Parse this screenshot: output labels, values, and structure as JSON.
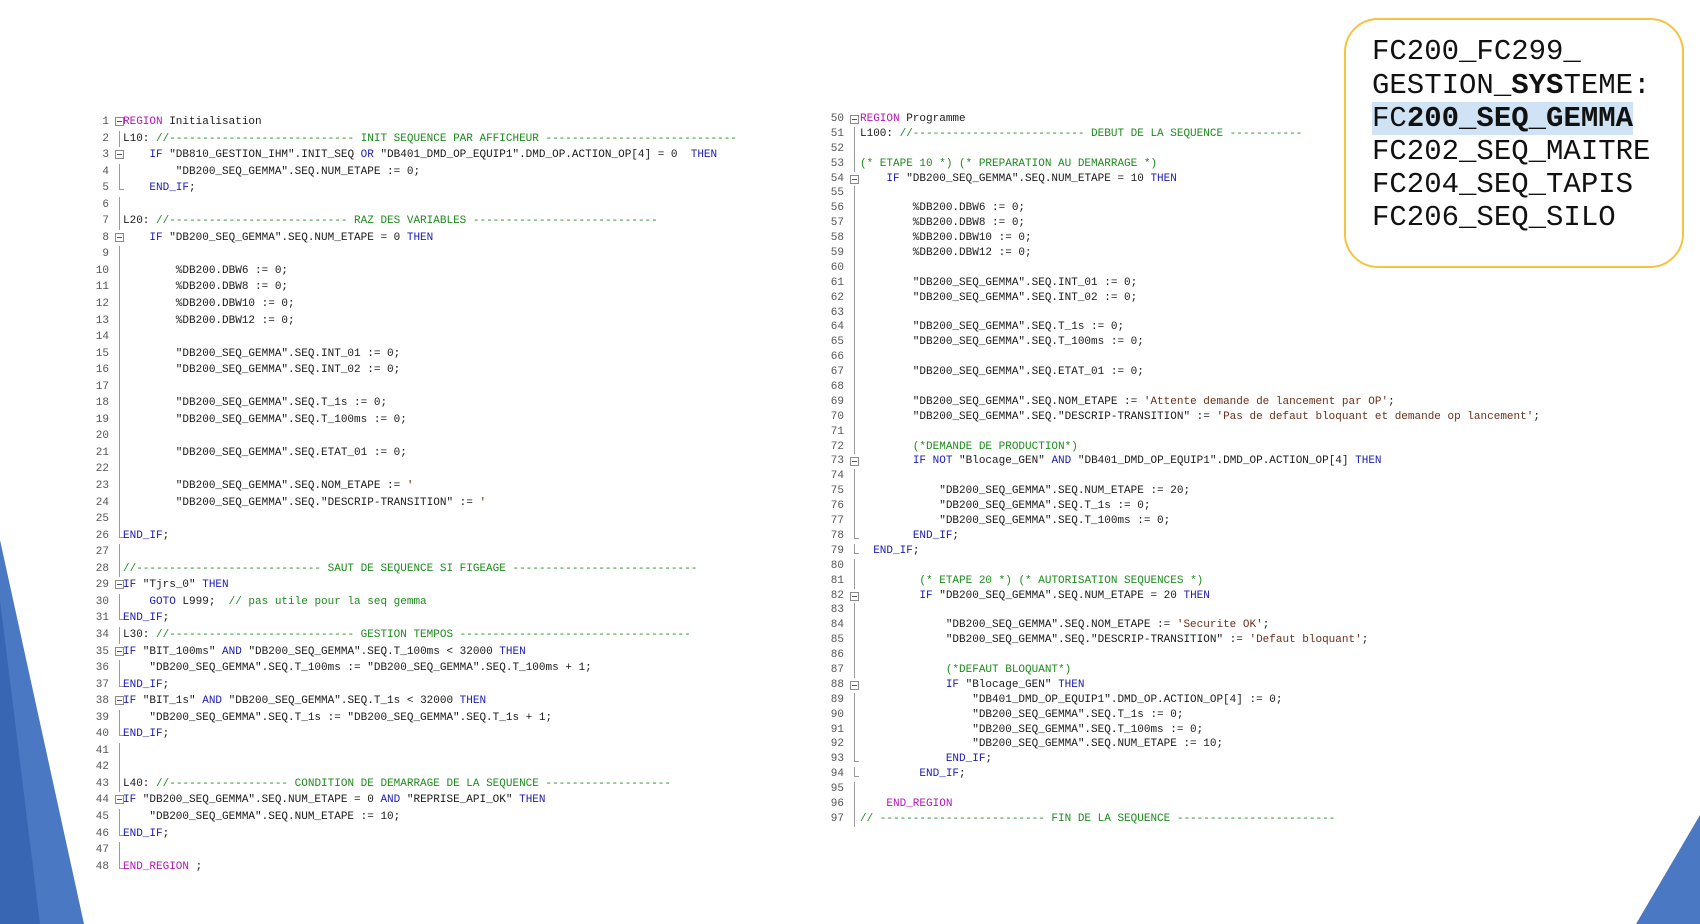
{
  "callout": {
    "lines": [
      {
        "a": "FC200_FC299_",
        "b": "",
        "c": ""
      },
      {
        "a": "GESTION_",
        "b": "SYS",
        "c": "TEME:"
      },
      {
        "a": "FC",
        "b": "200_SEQ_GEMMA",
        "c": ""
      },
      {
        "a": "FC202_SEQ_MAITRE",
        "b": "",
        "c": ""
      },
      {
        "a": "FC204_SEQ_TAPIS",
        "b": "",
        "c": ""
      },
      {
        "a": "FC206_SEQ_SILO",
        "b": "",
        "c": ""
      }
    ]
  },
  "left_code": [
    {
      "n": "1",
      "g": "fold",
      "t": [
        [
          "kwm",
          "REGION"
        ],
        [
          "plain",
          " Initialisation"
        ]
      ]
    },
    {
      "n": "2",
      "g": "bar",
      "t": [
        [
          "plain",
          "L10: "
        ],
        [
          "cm",
          "//---------------------------- INIT SEQUENCE PAR AFFICHEUR -----------------------------"
        ]
      ]
    },
    {
      "n": "3",
      "g": "fold",
      "t": [
        [
          "plain",
          "    "
        ],
        [
          "kw",
          "IF"
        ],
        [
          "plain",
          " \"DB810_GESTION_IHM\".INIT_SEQ "
        ],
        [
          "kw",
          "OR"
        ],
        [
          "plain",
          " \"DB401_DMD_OP_EQUIP1\".DMD_OP.ACTION_OP[4] = 0  "
        ],
        [
          "kw",
          "THEN"
        ]
      ]
    },
    {
      "n": "4",
      "g": "bar",
      "t": [
        [
          "plain",
          "        \"DB200_SEQ_GEMMA\".SEQ.NUM_ETAPE := 0;"
        ]
      ]
    },
    {
      "n": "5",
      "g": "end",
      "t": [
        [
          "plain",
          "    "
        ],
        [
          "kw",
          "END_IF"
        ],
        [
          "plain",
          ";"
        ]
      ]
    },
    {
      "n": "6",
      "g": "bar",
      "t": [
        [
          "plain",
          ""
        ]
      ]
    },
    {
      "n": "7",
      "g": "bar",
      "t": [
        [
          "plain",
          "L20: "
        ],
        [
          "cm",
          "//--------------------------- RAZ DES VARIABLES ----------------------------"
        ]
      ]
    },
    {
      "n": "8",
      "g": "fold",
      "t": [
        [
          "plain",
          "    "
        ],
        [
          "kw",
          "IF"
        ],
        [
          "plain",
          " \"DB200_SEQ_GEMMA\".SEQ.NUM_ETAPE = 0 "
        ],
        [
          "kw",
          "THEN"
        ]
      ]
    },
    {
      "n": "9",
      "g": "bar",
      "t": [
        [
          "plain",
          ""
        ]
      ]
    },
    {
      "n": "10",
      "g": "bar",
      "t": [
        [
          "plain",
          "        %DB200.DBW6 := 0;"
        ]
      ]
    },
    {
      "n": "11",
      "g": "bar",
      "t": [
        [
          "plain",
          "        %DB200.DBW8 := 0;"
        ]
      ]
    },
    {
      "n": "12",
      "g": "bar",
      "t": [
        [
          "plain",
          "        %DB200.DBW10 := 0;"
        ]
      ]
    },
    {
      "n": "13",
      "g": "bar",
      "t": [
        [
          "plain",
          "        %DB200.DBW12 := 0;"
        ]
      ]
    },
    {
      "n": "14",
      "g": "bar",
      "t": [
        [
          "plain",
          ""
        ]
      ]
    },
    {
      "n": "15",
      "g": "bar",
      "t": [
        [
          "plain",
          "        \"DB200_SEQ_GEMMA\".SEQ.INT_01 := 0;"
        ]
      ]
    },
    {
      "n": "16",
      "g": "bar",
      "t": [
        [
          "plain",
          "        \"DB200_SEQ_GEMMA\".SEQ.INT_02 := 0;"
        ]
      ]
    },
    {
      "n": "17",
      "g": "bar",
      "t": [
        [
          "plain",
          ""
        ]
      ]
    },
    {
      "n": "18",
      "g": "bar",
      "t": [
        [
          "plain",
          "        \"DB200_SEQ_GEMMA\".SEQ.T_1s := 0;"
        ]
      ]
    },
    {
      "n": "19",
      "g": "bar",
      "t": [
        [
          "plain",
          "        \"DB200_SEQ_GEMMA\".SEQ.T_100ms := 0;"
        ]
      ]
    },
    {
      "n": "20",
      "g": "bar",
      "t": [
        [
          "plain",
          ""
        ]
      ]
    },
    {
      "n": "21",
      "g": "bar",
      "t": [
        [
          "plain",
          "        \"DB200_SEQ_GEMMA\".SEQ.ETAT_01 := 0;"
        ]
      ]
    },
    {
      "n": "22",
      "g": "bar",
      "t": [
        [
          "plain",
          ""
        ]
      ]
    },
    {
      "n": "23",
      "g": "bar",
      "t": [
        [
          "plain",
          "        \"DB200_SEQ_GEMMA\".SEQ.NOM_ETAPE := "
        ],
        [
          "str",
          "'"
        ]
      ]
    },
    {
      "n": "24",
      "g": "bar",
      "t": [
        [
          "plain",
          "        \"DB200_SEQ_GEMMA\".SEQ.\"DESCRIP-TRANSITION\" := "
        ],
        [
          "str",
          "'"
        ]
      ]
    },
    {
      "n": "25",
      "g": "bar",
      "t": [
        [
          "plain",
          ""
        ]
      ]
    },
    {
      "n": "26",
      "g": "end",
      "t": [
        [
          "kw",
          "END_IF"
        ],
        [
          "plain",
          ";"
        ]
      ]
    },
    {
      "n": "27",
      "g": "bar",
      "t": [
        [
          "plain",
          ""
        ]
      ]
    },
    {
      "n": "28",
      "g": "bar",
      "t": [
        [
          "cm",
          "//---------------------------- SAUT DE SEQUENCE SI FIGEAGE ----------------------------"
        ]
      ]
    },
    {
      "n": "29",
      "g": "fold",
      "t": [
        [
          "kw",
          "IF"
        ],
        [
          "plain",
          " \"Tjrs_0\" "
        ],
        [
          "kw",
          "THEN"
        ]
      ]
    },
    {
      "n": "30",
      "g": "bar",
      "t": [
        [
          "plain",
          "    "
        ],
        [
          "kw",
          "GOTO"
        ],
        [
          "plain",
          " L999;  "
        ],
        [
          "cm",
          "// pas utile pour la seq gemma"
        ]
      ]
    },
    {
      "n": "31",
      "g": "end",
      "t": [
        [
          "kw",
          "END_IF"
        ],
        [
          "plain",
          ";"
        ]
      ]
    },
    {
      "n": "34",
      "g": "bar",
      "t": [
        [
          "plain",
          "L30: "
        ],
        [
          "cm",
          "//---------------------------- GESTION TEMPOS -----------------------------------"
        ]
      ]
    },
    {
      "n": "35",
      "g": "fold",
      "t": [
        [
          "kw",
          "IF"
        ],
        [
          "plain",
          " \"BIT_100ms\" "
        ],
        [
          "kw",
          "AND"
        ],
        [
          "plain",
          " \"DB200_SEQ_GEMMA\".SEQ.T_100ms < 32000 "
        ],
        [
          "kw",
          "THEN"
        ]
      ]
    },
    {
      "n": "36",
      "g": "bar",
      "t": [
        [
          "plain",
          "    \"DB200_SEQ_GEMMA\".SEQ.T_100ms := \"DB200_SEQ_GEMMA\".SEQ.T_100ms + 1;"
        ]
      ]
    },
    {
      "n": "37",
      "g": "end",
      "t": [
        [
          "kw",
          "END_IF"
        ],
        [
          "plain",
          ";"
        ]
      ]
    },
    {
      "n": "38",
      "g": "fold",
      "t": [
        [
          "kw",
          "IF"
        ],
        [
          "plain",
          " \"BIT_1s\" "
        ],
        [
          "kw",
          "AND"
        ],
        [
          "plain",
          " \"DB200_SEQ_GEMMA\".SEQ.T_1s < 32000 "
        ],
        [
          "kw",
          "THEN"
        ]
      ]
    },
    {
      "n": "39",
      "g": "bar",
      "t": [
        [
          "plain",
          "    \"DB200_SEQ_GEMMA\".SEQ.T_1s := \"DB200_SEQ_GEMMA\".SEQ.T_1s + 1;"
        ]
      ]
    },
    {
      "n": "40",
      "g": "end",
      "t": [
        [
          "kw",
          "END_IF"
        ],
        [
          "plain",
          ";"
        ]
      ]
    },
    {
      "n": "41",
      "g": "bar",
      "t": [
        [
          "plain",
          ""
        ]
      ]
    },
    {
      "n": "42",
      "g": "bar",
      "t": [
        [
          "plain",
          ""
        ]
      ]
    },
    {
      "n": "43",
      "g": "bar",
      "t": [
        [
          "plain",
          "L40: "
        ],
        [
          "cm",
          "//------------------ CONDITION DE DEMARRAGE DE LA SEQUENCE -------------------"
        ]
      ]
    },
    {
      "n": "44",
      "g": "fold",
      "t": [
        [
          "kw",
          "IF"
        ],
        [
          "plain",
          " \"DB200_SEQ_GEMMA\".SEQ.NUM_ETAPE = 0 "
        ],
        [
          "kw",
          "AND"
        ],
        [
          "plain",
          " \"REPRISE_API_OK\" "
        ],
        [
          "kw",
          "THEN"
        ]
      ]
    },
    {
      "n": "45",
      "g": "bar",
      "t": [
        [
          "plain",
          "    \"DB200_SEQ_GEMMA\".SEQ.NUM_ETAPE := 10;"
        ]
      ]
    },
    {
      "n": "46",
      "g": "end",
      "t": [
        [
          "kw",
          "END_IF"
        ],
        [
          "plain",
          ";"
        ]
      ]
    },
    {
      "n": "47",
      "g": "bar",
      "t": [
        [
          "plain",
          ""
        ]
      ]
    },
    {
      "n": "48",
      "g": "end",
      "t": [
        [
          "kwm",
          "END_REGION"
        ],
        [
          "plain",
          " ;"
        ]
      ]
    }
  ],
  "right_code": [
    {
      "n": "50",
      "g": "fold",
      "t": [
        [
          "kwm",
          "REGION"
        ],
        [
          "plain",
          " Programme"
        ]
      ]
    },
    {
      "n": "51",
      "g": "bar",
      "t": [
        [
          "plain",
          "L100: "
        ],
        [
          "cm",
          "//-------------------------- DEBUT DE LA SEQUENCE -----------"
        ]
      ]
    },
    {
      "n": "52",
      "g": "bar",
      "t": [
        [
          "plain",
          ""
        ]
      ]
    },
    {
      "n": "53",
      "g": "bar",
      "t": [
        [
          "cm",
          "(* ETAPE 10 *) (* PREPARATION AU DEMARRAGE *)"
        ]
      ]
    },
    {
      "n": "54",
      "g": "fold",
      "t": [
        [
          "plain",
          "    "
        ],
        [
          "kw",
          "IF"
        ],
        [
          "plain",
          " \"DB200_SEQ_GEMMA\".SEQ.NUM_ETAPE = 10 "
        ],
        [
          "kw",
          "THEN"
        ]
      ]
    },
    {
      "n": "55",
      "g": "bar",
      "t": [
        [
          "plain",
          ""
        ]
      ]
    },
    {
      "n": "56",
      "g": "bar",
      "t": [
        [
          "plain",
          "        %DB200.DBW6 := 0;"
        ]
      ]
    },
    {
      "n": "57",
      "g": "bar",
      "t": [
        [
          "plain",
          "        %DB200.DBW8 := 0;"
        ]
      ]
    },
    {
      "n": "58",
      "g": "bar",
      "t": [
        [
          "plain",
          "        %DB200.DBW10 := 0;"
        ]
      ]
    },
    {
      "n": "59",
      "g": "bar",
      "t": [
        [
          "plain",
          "        %DB200.DBW12 := 0;"
        ]
      ]
    },
    {
      "n": "60",
      "g": "bar",
      "t": [
        [
          "plain",
          ""
        ]
      ]
    },
    {
      "n": "61",
      "g": "bar",
      "t": [
        [
          "plain",
          "        \"DB200_SEQ_GEMMA\".SEQ.INT_01 := 0;"
        ]
      ]
    },
    {
      "n": "62",
      "g": "bar",
      "t": [
        [
          "plain",
          "        \"DB200_SEQ_GEMMA\".SEQ.INT_02 := 0;"
        ]
      ]
    },
    {
      "n": "63",
      "g": "bar",
      "t": [
        [
          "plain",
          ""
        ]
      ]
    },
    {
      "n": "64",
      "g": "bar",
      "t": [
        [
          "plain",
          "        \"DB200_SEQ_GEMMA\".SEQ.T_1s := 0;"
        ]
      ]
    },
    {
      "n": "65",
      "g": "bar",
      "t": [
        [
          "plain",
          "        \"DB200_SEQ_GEMMA\".SEQ.T_100ms := 0;"
        ]
      ]
    },
    {
      "n": "66",
      "g": "bar",
      "t": [
        [
          "plain",
          ""
        ]
      ]
    },
    {
      "n": "67",
      "g": "bar",
      "t": [
        [
          "plain",
          "        \"DB200_SEQ_GEMMA\".SEQ.ETAT_01 := 0;"
        ]
      ]
    },
    {
      "n": "68",
      "g": "bar",
      "t": [
        [
          "plain",
          ""
        ]
      ]
    },
    {
      "n": "69",
      "g": "bar",
      "t": [
        [
          "plain",
          "        \"DB200_SEQ_GEMMA\".SEQ.NOM_ETAPE := "
        ],
        [
          "str",
          "'Attente demande de lancement par OP'"
        ],
        [
          "plain",
          ";"
        ]
      ]
    },
    {
      "n": "70",
      "g": "bar",
      "t": [
        [
          "plain",
          "        \"DB200_SEQ_GEMMA\".SEQ.\"DESCRIP-TRANSITION\" := "
        ],
        [
          "str",
          "'Pas de defaut bloquant et demande op lancement'"
        ],
        [
          "plain",
          ";"
        ]
      ]
    },
    {
      "n": "71",
      "g": "bar",
      "t": [
        [
          "plain",
          ""
        ]
      ]
    },
    {
      "n": "72",
      "g": "bar",
      "t": [
        [
          "cm",
          "        (*DEMANDE DE PRODUCTION*)"
        ]
      ]
    },
    {
      "n": "73",
      "g": "fold",
      "t": [
        [
          "plain",
          "        "
        ],
        [
          "kw",
          "IF NOT"
        ],
        [
          "plain",
          " \"Blocage_GEN\" "
        ],
        [
          "kw",
          "AND"
        ],
        [
          "plain",
          " \"DB401_DMD_OP_EQUIP1\".DMD_OP.ACTION_OP[4] "
        ],
        [
          "kw",
          "THEN"
        ]
      ]
    },
    {
      "n": "74",
      "g": "bar",
      "t": [
        [
          "plain",
          ""
        ]
      ]
    },
    {
      "n": "75",
      "g": "bar",
      "t": [
        [
          "plain",
          "            \"DB200_SEQ_GEMMA\".SEQ.NUM_ETAPE := 20;"
        ]
      ]
    },
    {
      "n": "76",
      "g": "bar",
      "t": [
        [
          "plain",
          "            \"DB200_SEQ_GEMMA\".SEQ.T_1s := 0;"
        ]
      ]
    },
    {
      "n": "77",
      "g": "bar",
      "t": [
        [
          "plain",
          "            \"DB200_SEQ_GEMMA\".SEQ.T_100ms := 0;"
        ]
      ]
    },
    {
      "n": "78",
      "g": "end",
      "t": [
        [
          "plain",
          "        "
        ],
        [
          "kw",
          "END_IF"
        ],
        [
          "plain",
          ";"
        ]
      ]
    },
    {
      "n": "79",
      "g": "end",
      "t": [
        [
          "plain",
          "  "
        ],
        [
          "kw",
          "END_IF"
        ],
        [
          "plain",
          ";"
        ]
      ]
    },
    {
      "n": "80",
      "g": "bar",
      "t": [
        [
          "plain",
          ""
        ]
      ]
    },
    {
      "n": "81",
      "g": "bar",
      "t": [
        [
          "plain",
          "         "
        ],
        [
          "cm",
          "(* ETAPE 20 *) (* AUTORISATION SEQUENCES *)"
        ]
      ]
    },
    {
      "n": "82",
      "g": "fold",
      "t": [
        [
          "plain",
          "         "
        ],
        [
          "kw",
          "IF"
        ],
        [
          "plain",
          " \"DB200_SEQ_GEMMA\".SEQ.NUM_ETAPE = 20 "
        ],
        [
          "kw",
          "THEN"
        ]
      ]
    },
    {
      "n": "83",
      "g": "bar",
      "t": [
        [
          "plain",
          ""
        ]
      ]
    },
    {
      "n": "84",
      "g": "bar",
      "t": [
        [
          "plain",
          "             \"DB200_SEQ_GEMMA\".SEQ.NOM_ETAPE := "
        ],
        [
          "str",
          "'Securite OK'"
        ],
        [
          "plain",
          ";"
        ]
      ]
    },
    {
      "n": "85",
      "g": "bar",
      "t": [
        [
          "plain",
          "             \"DB200_SEQ_GEMMA\".SEQ.\"DESCRIP-TRANSITION\" := "
        ],
        [
          "str",
          "'Defaut bloquant'"
        ],
        [
          "plain",
          ";"
        ]
      ]
    },
    {
      "n": "86",
      "g": "bar",
      "t": [
        [
          "plain",
          ""
        ]
      ]
    },
    {
      "n": "87",
      "g": "bar",
      "t": [
        [
          "cm",
          "             (*DEFAUT BLOQUANT*)"
        ]
      ]
    },
    {
      "n": "88",
      "g": "fold",
      "t": [
        [
          "plain",
          "             "
        ],
        [
          "kw",
          "IF"
        ],
        [
          "plain",
          " \"Blocage_GEN\" "
        ],
        [
          "kw",
          "THEN"
        ]
      ]
    },
    {
      "n": "89",
      "g": "bar",
      "t": [
        [
          "plain",
          "                 \"DB401_DMD_OP_EQUIP1\".DMD_OP.ACTION_OP[4] := 0;"
        ]
      ]
    },
    {
      "n": "90",
      "g": "bar",
      "t": [
        [
          "plain",
          "                 \"DB200_SEQ_GEMMA\".SEQ.T_1s := 0;"
        ]
      ]
    },
    {
      "n": "91",
      "g": "bar",
      "t": [
        [
          "plain",
          "                 \"DB200_SEQ_GEMMA\".SEQ.T_100ms := 0;"
        ]
      ]
    },
    {
      "n": "92",
      "g": "bar",
      "t": [
        [
          "plain",
          "                 \"DB200_SEQ_GEMMA\".SEQ.NUM_ETAPE := 10;"
        ]
      ]
    },
    {
      "n": "93",
      "g": "end",
      "t": [
        [
          "plain",
          "             "
        ],
        [
          "kw",
          "END_IF"
        ],
        [
          "plain",
          ";"
        ]
      ]
    },
    {
      "n": "94",
      "g": "end",
      "t": [
        [
          "plain",
          "         "
        ],
        [
          "kw",
          "END_IF"
        ],
        [
          "plain",
          ";"
        ]
      ]
    },
    {
      "n": "95",
      "g": "bar",
      "t": [
        [
          "plain",
          ""
        ]
      ]
    },
    {
      "n": "96",
      "g": "bar",
      "t": [
        [
          "plain",
          "    "
        ],
        [
          "kwm",
          "END_REGION"
        ]
      ]
    },
    {
      "n": "97",
      "g": "bar",
      "t": [
        [
          "cm",
          "// ------------------------- FIN DE LA SEQUENCE ------------------------"
        ]
      ]
    }
  ]
}
